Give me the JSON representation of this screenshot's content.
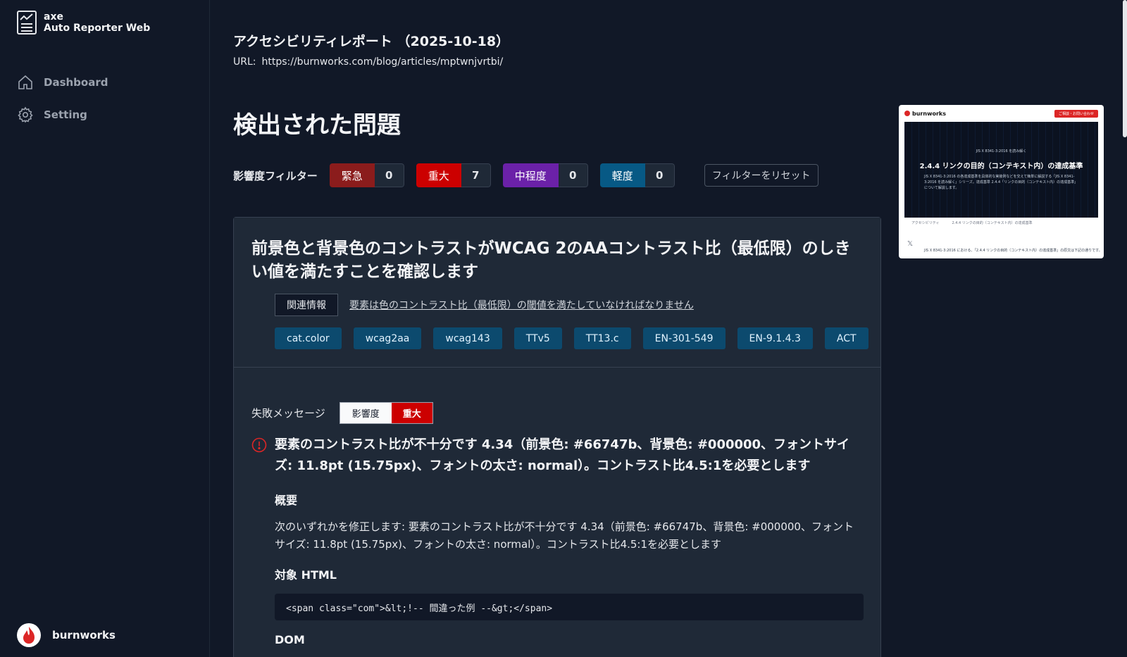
{
  "app": {
    "name": "axe",
    "subtitle": "Auto Reporter Web"
  },
  "sidebar": {
    "items": [
      {
        "label": "Dashboard",
        "icon": "home-icon"
      },
      {
        "label": "Setting",
        "icon": "gear-icon"
      }
    ],
    "footer_label": "burnworks"
  },
  "report": {
    "title": "アクセシビリティレポート （2025-10-18）",
    "url_label": "URL:",
    "url": "https://burnworks.com/blog/articles/mptwnjvrtbi/"
  },
  "section_title": "検出された問題",
  "filters": {
    "label": "影響度フィルター",
    "chips": [
      {
        "name": "緊急",
        "count": "0",
        "color": "#8b1c1c"
      },
      {
        "name": "重大",
        "count": "7",
        "color": "#cc0000"
      },
      {
        "name": "中程度",
        "count": "0",
        "color": "#6b21a8"
      },
      {
        "name": "軽度",
        "count": "0",
        "color": "#075985"
      }
    ],
    "reset_label": "フィルターをリセット"
  },
  "issue": {
    "title": "前景色と背景色のコントラストがWCAG 2のAAコントラスト比（最低限）のしきい値を満たすことを確認します",
    "related_label": "関連情報",
    "related_link": "要素は色のコントラスト比（最低限）の閾値を満たしていなければなりません",
    "tags": [
      "cat.color",
      "wcag2aa",
      "wcag143",
      "TTv5",
      "TT13.c",
      "EN-301-549",
      "EN-9.1.4.3",
      "ACT"
    ],
    "fail_label": "失敗メッセージ",
    "impact_key": "影響度",
    "impact_value": "重大",
    "message": "要素のコントラスト比が不十分です 4.34（前景色: #66747b、背景色: #000000、フォントサイズ: 11.8pt (15.75px)、フォントの太さ: normal）。コントラスト比4.5:1を必要とします",
    "summary_heading": "概要",
    "summary": "次のいずれかを修正します: 要素のコントラスト比が不十分です 4.34（前景色: #66747b、背景色: #000000、フォントサイズ: 11.8pt (15.75px)、フォントの太さ: normal）。コントラスト比4.5:1を必要とします",
    "target_heading": "対象 HTML",
    "target_html": "<span class=\"com\">&lt;!-- 間違った例 --&gt;</span>",
    "dom_heading": "DOM"
  },
  "preview": {
    "logo": "burnworks",
    "button": "ご相談・お問い合わせ",
    "kicker": "JIS X 8341-3:2016 を読み解く",
    "heading": "2.4.4 リンクの目的（コンテキスト内）の達成基準",
    "lede": "JIS X 8341-3:2016 の各達成基準を具体的な実装例などを交えて簡単に解説する「JIS X 8341-3:2016 を読み解く」シリーズ。達成基準 2.4.4「リンクの目的（コンテキスト内）の達成基準」について解説します。",
    "crumbs": [
      "アクセシビリティ",
      "2.4.4 リンクの目的（コンテキスト内）の達成基準"
    ],
    "body": "JIS X 8341-3:2016 における、「2.4.4 リンクの目的（コンテキスト内）の達成基準」の原文は下記の通りです。"
  }
}
